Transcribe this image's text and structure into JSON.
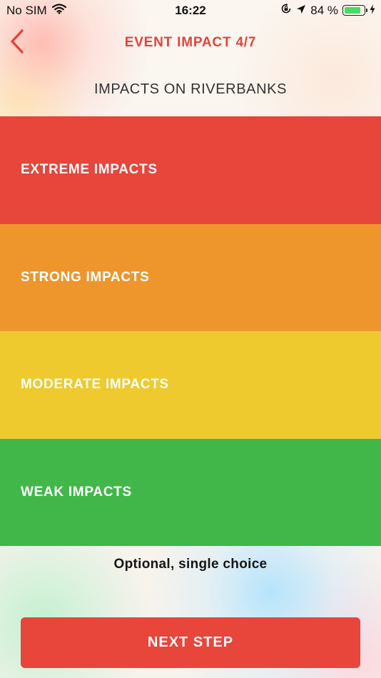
{
  "status_bar": {
    "carrier": "No SIM",
    "time": "16:22",
    "battery_percent": "84 %",
    "battery_level": 0.84,
    "icons": [
      "wifi-icon",
      "orientation-lock-icon",
      "location-arrow-icon",
      "battery-icon",
      "charging-bolt-icon"
    ]
  },
  "nav": {
    "title": "EVENT IMPACT 4/7",
    "back_icon": "chevron-left-icon"
  },
  "question": "IMPACTS ON RIVERBANKS",
  "choices": [
    {
      "label": "EXTREME IMPACTS",
      "color": "#e8453b"
    },
    {
      "label": "STRONG IMPACTS",
      "color": "#ee962c"
    },
    {
      "label": "MODERATE IMPACTS",
      "color": "#efca2f"
    },
    {
      "label": "WEAK IMPACTS",
      "color": "#41b74a"
    }
  ],
  "hint": "Optional, single choice",
  "next_button": {
    "label": "NEXT STEP",
    "color": "#e8453b"
  },
  "colors": {
    "accent": "#e84238"
  }
}
